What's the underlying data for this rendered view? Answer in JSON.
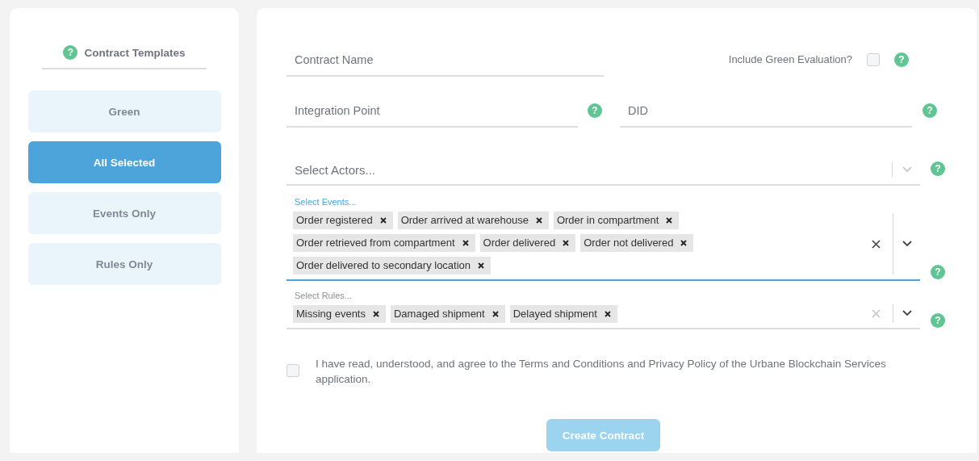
{
  "sidebar": {
    "title": "Contract Templates",
    "help": "?",
    "templates": [
      {
        "label": "Green",
        "selected": false
      },
      {
        "label": "All Selected",
        "selected": true
      },
      {
        "label": "Events Only",
        "selected": false
      },
      {
        "label": "Rules Only",
        "selected": false
      }
    ]
  },
  "form": {
    "contract_name": {
      "placeholder": "Contract Name"
    },
    "green_evaluation": {
      "label": "Include Green Evaluation?",
      "checked": false,
      "help": "?"
    },
    "integration_point": {
      "placeholder": "Integration Point",
      "help": "?"
    },
    "did": {
      "placeholder": "DID",
      "help": "?"
    },
    "actors": {
      "placeholder": "Select Actors...",
      "help": "?"
    },
    "events": {
      "label": "Select Events...",
      "focused": true,
      "help": "?",
      "values": [
        "Order registered",
        "Order arrived at warehouse",
        "Order in compartment",
        "Order retrieved from compartment",
        "Order delivered",
        "Order not delivered",
        "Order delivered to secondary location"
      ]
    },
    "rules": {
      "label": "Select Rules...",
      "focused": false,
      "help": "?",
      "values": [
        "Missing events",
        "Damaged shipment",
        "Delayed shipment"
      ]
    },
    "agreement": {
      "text": "I have read, understood, and agree to the Terms and Conditions and Privacy Policy of the Urbane Blockchain Services application.",
      "checked": false
    },
    "submit": {
      "label": "Create Contract",
      "disabled": true
    }
  }
}
